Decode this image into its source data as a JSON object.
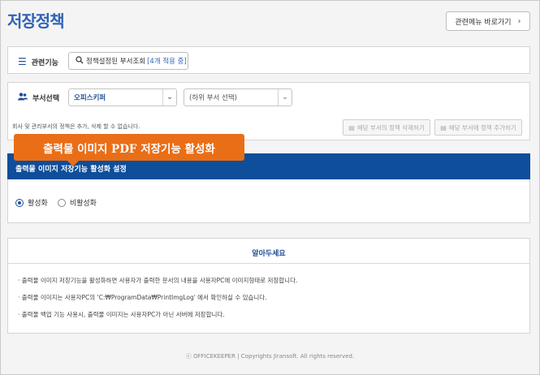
{
  "page": {
    "title": "저장정책"
  },
  "header": {
    "related_menu_label": "관련메뉴 바로가기",
    "chevron": "›"
  },
  "policy_row": {
    "label": "관련기능",
    "search_label": "정책설정된 부서조회",
    "count_badge": "[4개 적용 중]"
  },
  "dept_row": {
    "label": "부서선택",
    "select_value": "오피스키퍼",
    "sub_select_value": "(하위 부서 선택)"
  },
  "actions": {
    "note": "회사 및 관리부서의 정책은 추가, 삭제 할 수 없습니다.",
    "delete_label": "해당 부서의 정책 삭제하기",
    "add_label": "해당 부서에 정책 추가하기"
  },
  "tooltip": {
    "text": "출력물 이미지 PDF 저장기능 활성화"
  },
  "section": {
    "title": "출력물 이미지 저장기능 활성화 설정",
    "options": [
      "활성화",
      "비활성화"
    ],
    "selected": "활성화"
  },
  "notice": {
    "title": "알아두세요",
    "items": [
      "· 출력물 이미지 저장기능을 활성화하면 사용자가 출력한 문서의 내용을 사용자PC에 이미지형태로 저장합니다.",
      "· 출력물 이미지는 사용자PC의 'C:₩ProgramData₩PrintImgLog' 에서 확인하실 수 있습니다.",
      "· 출력물 백업 기능 사용시, 출력물 이미지는 사용자PC가 아닌 서버에 저장합니다."
    ]
  },
  "footer": {
    "text": "ⓒ OFFICEKEEPER | Copyrights Jiransoft. All rights reserved."
  },
  "colors": {
    "accent": "#2f63b8",
    "section_bar": "#0e4e9a",
    "tooltip": "#ea6e16"
  },
  "icons": {
    "list": "list-icon",
    "users": "users-icon",
    "search": "search-icon",
    "chevron": "chevron-right-icon",
    "chevron_down": "chevron-down-icon"
  }
}
